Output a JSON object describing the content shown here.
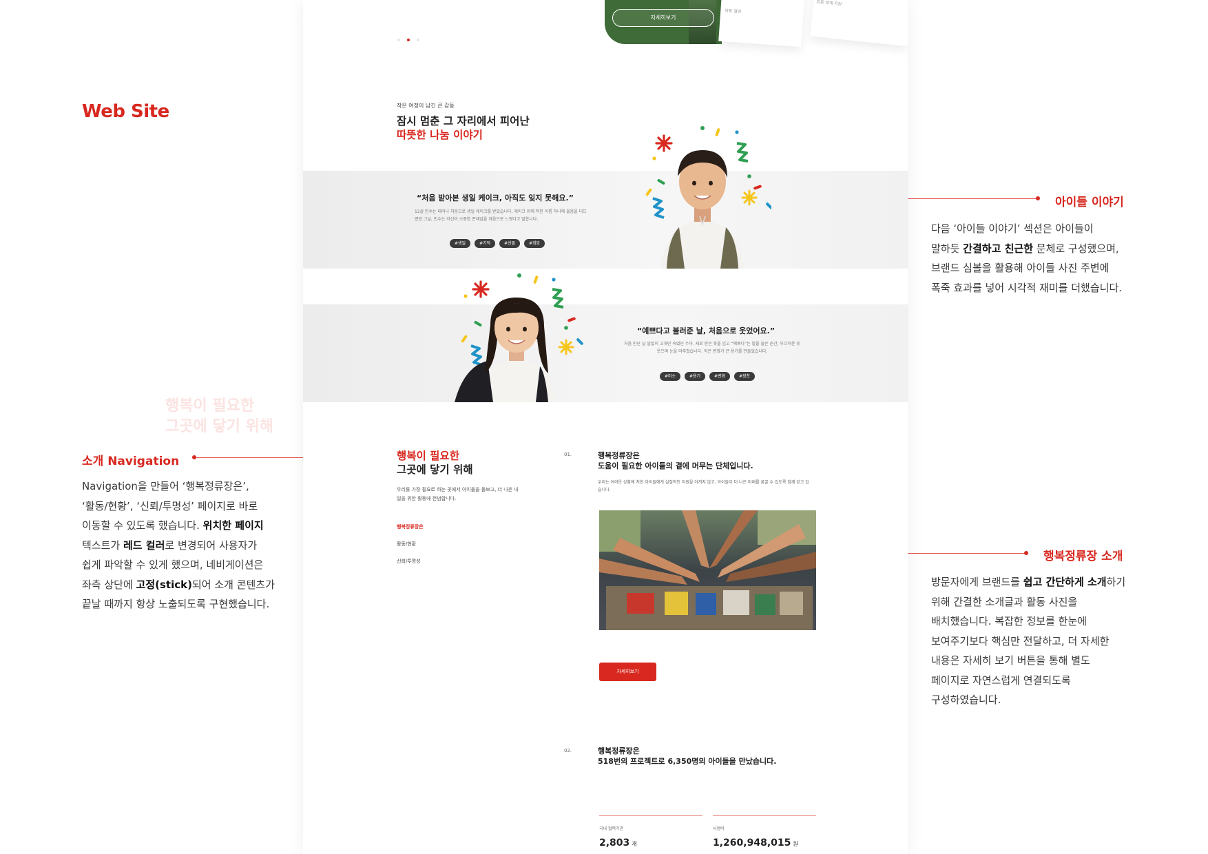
{
  "annotations": {
    "brand": "Web Site",
    "stories": {
      "title": "아이들 이야기",
      "body_parts": [
        {
          "t": "다음 ‘아이들 이야기’ 섹션은 아이들이 말하듯 ",
          "b": false
        },
        {
          "t": "간결하고 친근한",
          "b": true
        },
        {
          "t": " 문체로 구성했으며, 브랜드 심볼을 활용해 아이들 사진 주변에 폭죽 효과를 넣어 시각적 재미를 더했습니다.",
          "b": false
        }
      ]
    },
    "navigation": {
      "title": "소개 Navigation",
      "body_parts": [
        {
          "t": "Navigation을 만들어 ‘행복정류장은’, ‘활동/현황’, ‘신뢰/투명성’ 페이지로 바로 이동할 수 있도록 했습니다. ",
          "b": false
        },
        {
          "t": "위치한 페이지",
          "b": true
        },
        {
          "t": " 텍스트가 ",
          "b": false
        },
        {
          "t": "레드 컬러",
          "b": true
        },
        {
          "t": "로 변경되어 사용자가 쉽게 파악할 수 있게 했으며, 네비게이션은 좌측 상단에 ",
          "b": false
        },
        {
          "t": "고정(stick)",
          "b": true
        },
        {
          "t": "되어 소개 콘텐츠가 끝날 때까지 항상 노출되도록 구현했습니다.",
          "b": false
        }
      ]
    },
    "about": {
      "title": "행복정류장 소개",
      "body_parts": [
        {
          "t": "방문자에게 브랜드를 ",
          "b": false
        },
        {
          "t": "쉽고 간단하게 소개",
          "b": true
        },
        {
          "t": "하기 위해 간결한 소개글과 활동 사진을 배치했습니다. 복잡한 정보를 한눈에 보여주기보다 핵심만 전달하고, 더 자세한 내용은 자세히 보기 버튼을 통해 별도 페이지로 자연스럽게 연결되도록 구성하였습니다.",
          "b": false
        }
      ]
    }
  },
  "hero": {
    "button": "자세히보기",
    "paper_text_1": "아동 결연",
    "paper_text_2": "의료 생계 지원",
    "slides": 3,
    "active_slide": 2
  },
  "stories": {
    "eyebrow": "작은 여정이 남긴 큰 감동",
    "title_line1": "잠시 멈춘 그 자리에서 피어난",
    "title_line2": "따뜻한 나눔 이야기",
    "items": [
      {
        "quote": "“처음 받아본 생일 케이크, 아직도 잊지 못해요.”",
        "desc": "12살 민수는 태어나 처음으로 생일 케이크를 받았습니다. 케이크 위에 적힌 이름 하나에 울음을 터뜨렸던 그날, 민수는 자신이 소중한 존재임을 처음으로 느꼈다고 말합니다.",
        "tags": [
          "#생일",
          "#기억",
          "#선물",
          "#희망"
        ]
      },
      {
        "quote": "“예쁘다고 불러준 날, 처음으로 웃었어요.”",
        "desc": "처음 만난 날 말없이 고개만 숙였던 수아. 새로 받은 옷을 입고 “예쁘다”는 말을 들은 순간, 부끄러운 듯 웃으며 눈을 마주쳤습니다. 작은 변화가 큰 용기를 만들었습니다.",
        "tags": [
          "#미소",
          "#용기",
          "#변화",
          "#칭찬"
        ]
      }
    ]
  },
  "intro": {
    "title_line1": "행복이 필요한",
    "title_line2": "그곳에 닿기 위해",
    "desc": "우리를 가장 필요로 하는 곳에서 아이들을 돌보고, 더 나은 내일을 위한 활동에 전념합니다.",
    "nav": [
      "행복정류장은",
      "활동/현황",
      "신뢰/투명성"
    ],
    "nav_active": 0,
    "section1": {
      "num": "01.",
      "title_line1": "행복정류장은",
      "title_line2": "도움이 필요한 아이들의 곁에 머무는 단체입니다.",
      "desc": "우리는 어려운 상황에 처한 아이들에게 실질적인 지원을 아끼지 않고, 아이들이 더 나은 미래를 꿈꿀 수 있도록 힘께 걷고 있습니다.",
      "button": "자세히보기"
    },
    "section2": {
      "num": "02.",
      "title_line1": "행복정류장은",
      "title_line2": "518번의 프로젝트로 6,350명의 아이들을 만났습니다.",
      "stats": [
        {
          "label": "국내 협력기관",
          "value": "2,803",
          "unit": "개"
        },
        {
          "label": "사업비",
          "value": "1,260,948,015",
          "unit": "원"
        }
      ]
    }
  },
  "colors": {
    "accent": "#d8281f",
    "tag_bg": "#3b3b3b"
  }
}
